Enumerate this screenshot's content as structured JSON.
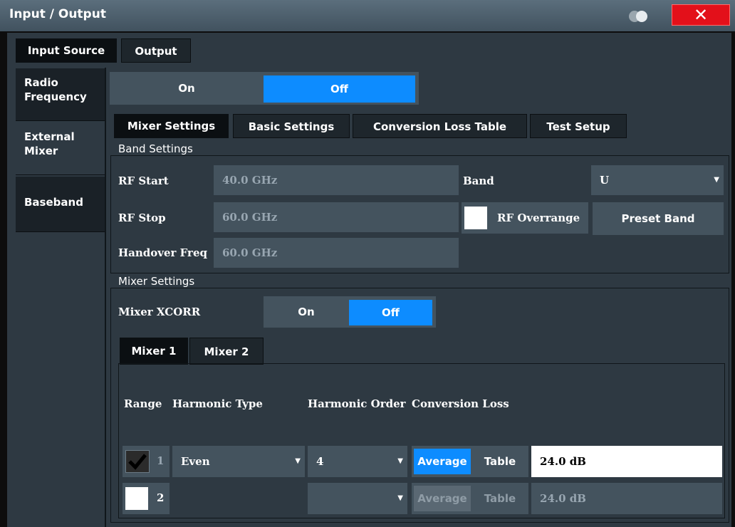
{
  "window": {
    "title": "Input / Output",
    "close": "✕"
  },
  "top_tabs": [
    "Input Source",
    "Output"
  ],
  "side_tabs": [
    {
      "line1": "Radio",
      "line2": "Frequency"
    },
    {
      "line1": "External",
      "line2": "Mixer"
    },
    {
      "line1": "Baseband",
      "line2": ""
    }
  ],
  "state_toggle": {
    "on": "On",
    "off": "Off",
    "selected": "Off"
  },
  "sub_tabs": [
    "Mixer Settings",
    "Basic Settings",
    "Conversion Loss Table",
    "Test Setup"
  ],
  "band_settings": {
    "label": "Band Settings",
    "rf_start_label": "RF Start",
    "rf_start": "40.0 GHz",
    "rf_stop_label": "RF Stop",
    "rf_stop": "60.0 GHz",
    "handover_label": "Handover Freq",
    "handover": "60.0 GHz",
    "band_label": "Band",
    "band": "U",
    "rf_overrange_label": "RF Overrange",
    "rf_overrange_checked": false,
    "preset_band": "Preset Band"
  },
  "mixer_settings": {
    "label": "Mixer Settings",
    "xcorr_label": "Mixer XCORR",
    "xcorr_on": "On",
    "xcorr_off": "Off",
    "xcorr_selected": "Off",
    "mixer_tabs": [
      "Mixer 1",
      "Mixer 2"
    ],
    "headers": {
      "range": "Range",
      "harmonic_type": "Harmonic Type",
      "harmonic_order": "Harmonic Order",
      "conversion_loss": "Conversion Loss"
    },
    "rows": [
      {
        "checked": true,
        "range": "1",
        "harmonic_type": "Even",
        "harmonic_order": "4",
        "mode_average": "Average",
        "mode_table": "Table",
        "loss": "24.0 dB",
        "enabled": true
      },
      {
        "checked": false,
        "range": "2",
        "harmonic_type": "",
        "harmonic_order": "",
        "mode_average": "Average",
        "mode_table": "Table",
        "loss": "24.0 dB",
        "enabled": false
      }
    ]
  },
  "colors": {
    "accent": "#0d8cff",
    "close": "#e3101a",
    "panel": "#2e3942",
    "field": "#44535e"
  }
}
